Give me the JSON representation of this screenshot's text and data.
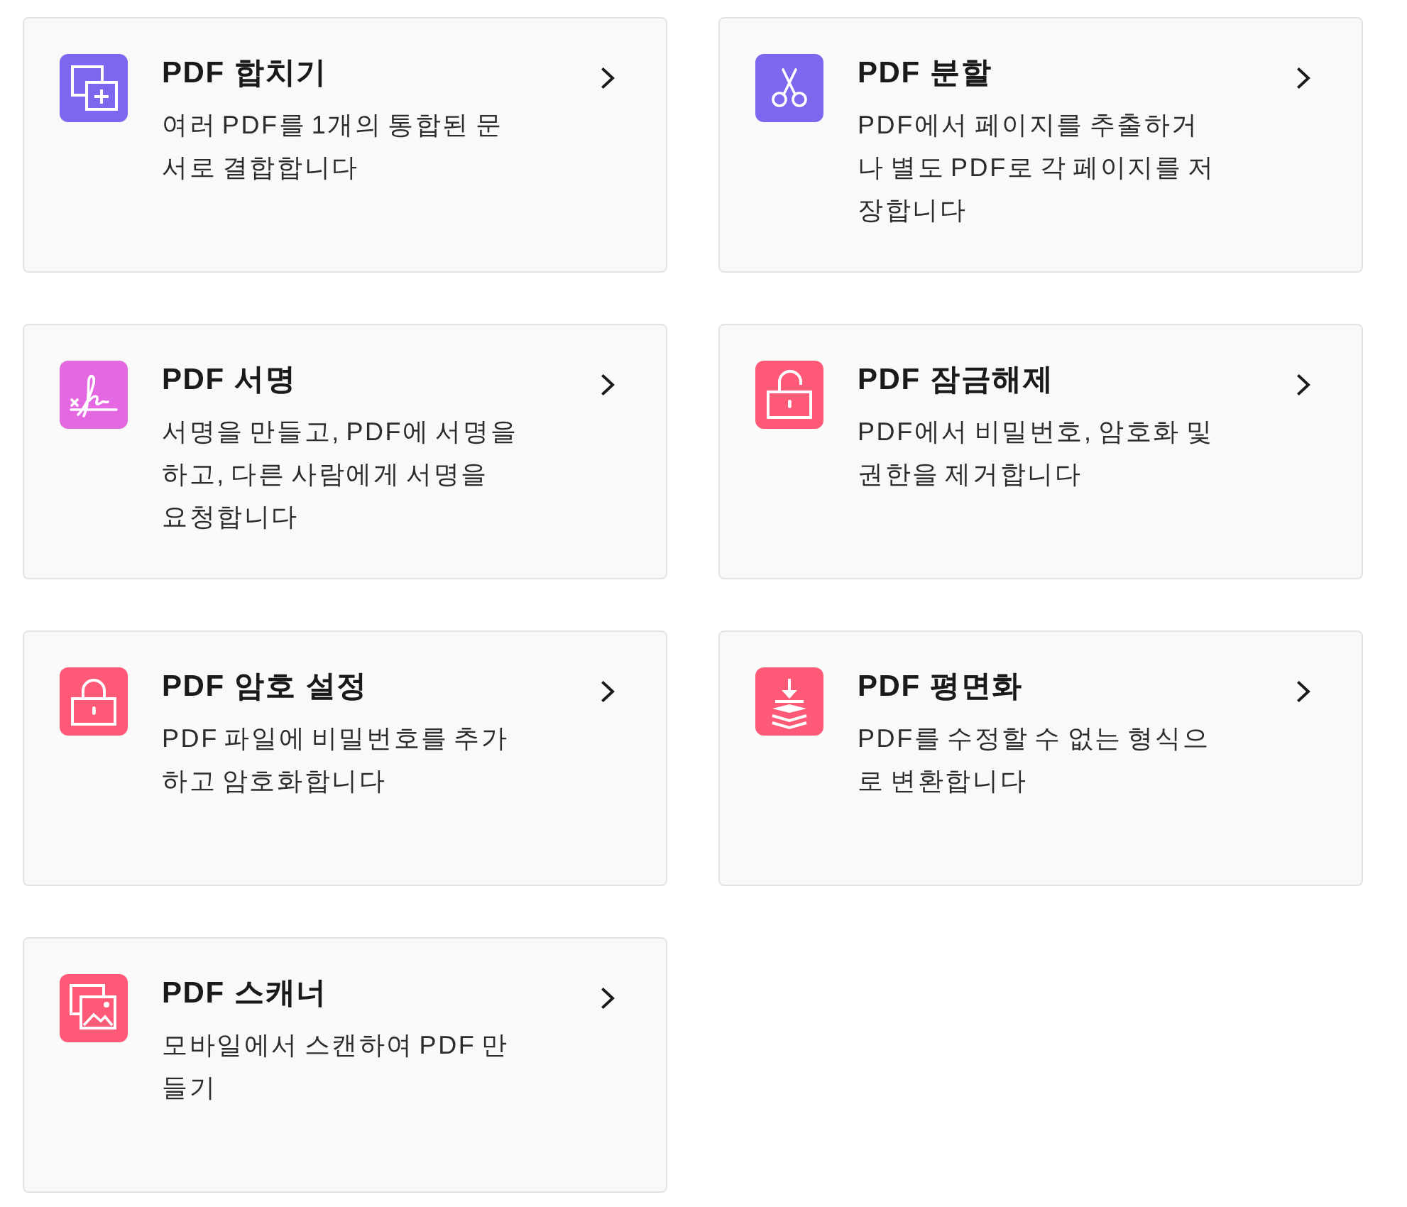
{
  "tools": [
    {
      "kind": "merge",
      "color": "#7b68ee",
      "title": "PDF 합치기",
      "description": "여러 PDF를 1개의 통합된 문서로 결합합니다"
    },
    {
      "kind": "split",
      "color": "#7b68ee",
      "title": "PDF 분할",
      "description": "PDF에서 페이지를 추출하거나 별도 PDF로 각 페이지를 저장합니다"
    },
    {
      "kind": "sign",
      "color": "#e468e2",
      "title": "PDF 서명",
      "description": "서명을 만들고, PDF에 서명을 하고, 다른 사람에게 서명을 요청합니다"
    },
    {
      "kind": "unlock",
      "color": "#fe5a77",
      "title": "PDF 잠금해제",
      "description": "PDF에서 비밀번호, 암호화 및 권한을 제거합니다"
    },
    {
      "kind": "lock",
      "color": "#fe5a77",
      "title": "PDF 암호 설정",
      "description": "PDF 파일에 비밀번호를 추가하고 암호화합니다"
    },
    {
      "kind": "flatten",
      "color": "#fe5a77",
      "title": "PDF 평면화",
      "description": "PDF를 수정할 수 없는 형식으로 변환합니다"
    },
    {
      "kind": "scan",
      "color": "#fe5a77",
      "title": "PDF 스캐너",
      "description": "모바일에서 스캔하여 PDF 만들기"
    }
  ]
}
